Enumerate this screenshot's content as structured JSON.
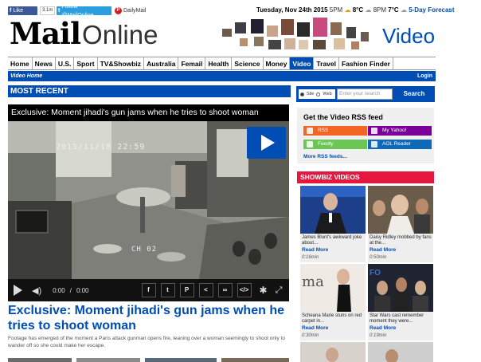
{
  "social": {
    "facebook_like": "Like",
    "facebook_count": "3.1m",
    "twitter_follow": "Follow @MailOnline",
    "pinterest": "DailyMail"
  },
  "topbar": {
    "date": "Tuesday, Nov 24th 2015",
    "time1": "5PM",
    "temp1": "8°C",
    "time2": "8PM",
    "temp2": "7°C",
    "forecast": "5-Day Forecast"
  },
  "logo": {
    "part1": "Mail",
    "part2": "Online"
  },
  "section_title": "Video",
  "nav": {
    "items": [
      "Home",
      "News",
      "U.S.",
      "Sport",
      "TV&Showbiz",
      "Australia",
      "Femail",
      "Health",
      "Science",
      "Money",
      "Video",
      "Travel",
      "Fashion Finder"
    ],
    "active": "Video"
  },
  "subnav": {
    "video_home": "Video Home",
    "login": "Login"
  },
  "most_recent": "MOST RECENT",
  "player": {
    "title": "Exclusive: Moment jihadi's gun jams when he tries to shoot woman",
    "timestamp": "2015/11/18 22:59",
    "camera": "CH 02",
    "current_time": "0:00",
    "separator": "/",
    "duration": "0:00"
  },
  "headline": "Exclusive: Moment jihadi's gun jams when he tries to shoot woman",
  "summary": "Footage has emerged of the moment a Paris attack gunman opens fire, leaning over a woman seemingly to shoot only to wander off so she could make her escape.",
  "search": {
    "site_label": "Site",
    "web_label": "Web",
    "placeholder": "Enter your search",
    "button": "Search"
  },
  "rss": {
    "title": "Get the Video RSS feed",
    "buttons": [
      "RSS",
      "My Yahoo!",
      "Feedly",
      "AOL Reader"
    ],
    "more": "More RSS feeds..."
  },
  "showbiz": {
    "title": "SHOWBIZ VIDEOS",
    "videos": [
      {
        "caption": "James Blunt's awkward joke about...",
        "read_more": "Read More",
        "duration": "0:16min"
      },
      {
        "caption": "Daisy Ridley mobbed by fans at the...",
        "read_more": "Read More",
        "duration": "0:50min"
      },
      {
        "caption": "Scheana Marie stuns on red carpet in...",
        "read_more": "Read More",
        "duration": "0:30min"
      },
      {
        "caption": "Star Wars cast remember moment they were...",
        "read_more": "Read More",
        "duration": "0:19min"
      }
    ]
  },
  "colors": {
    "brand_blue": "#004db3",
    "showbiz_red": "#e5173f",
    "rss_orange": "#f26522",
    "yahoo_purple": "#7b0099",
    "feedly_green": "#6cc655",
    "aol_blue": "#0e6ab8"
  }
}
